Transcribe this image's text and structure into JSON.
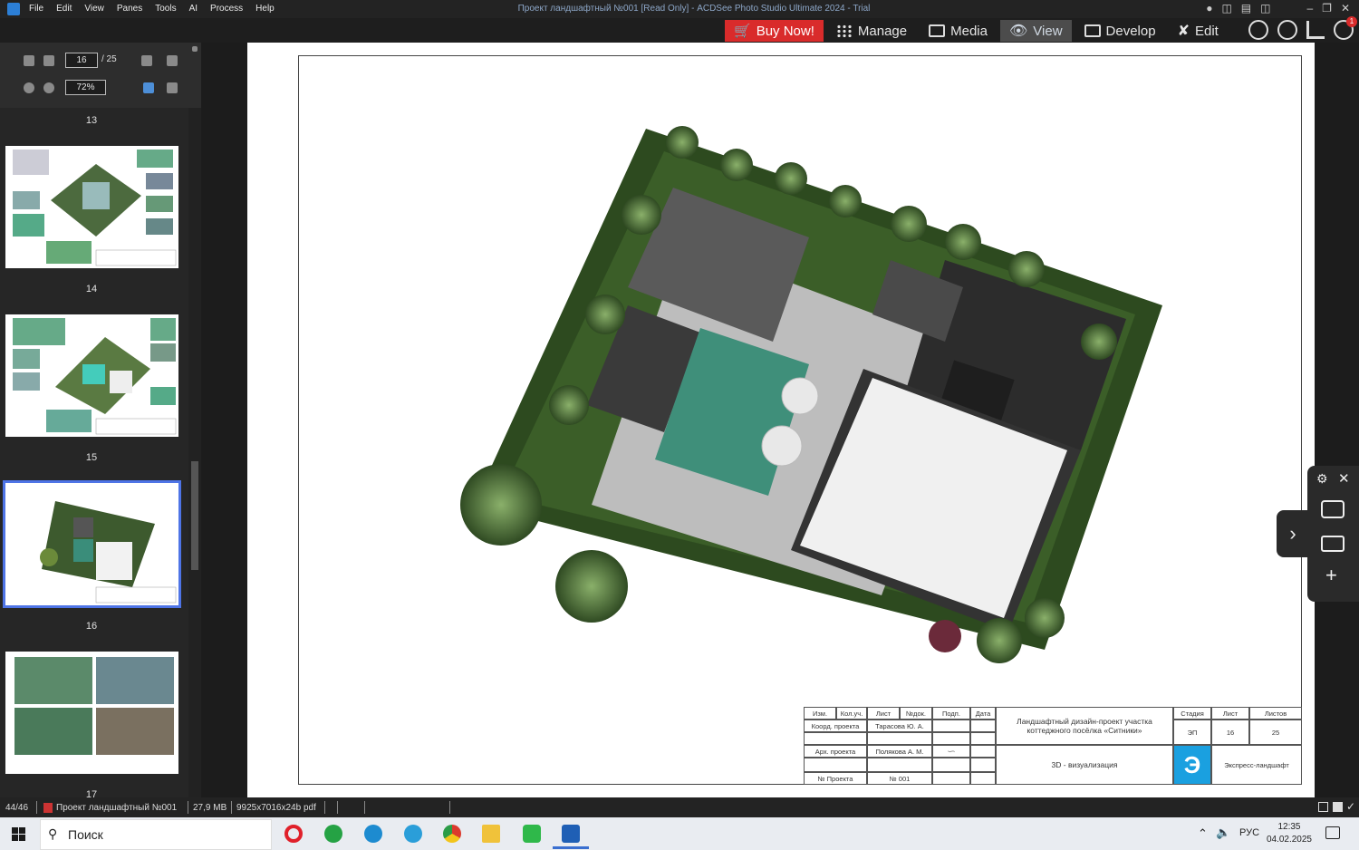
{
  "window": {
    "title": "Проект ландшафтный №001 [Read Only] - ACDSee Photo Studio Ultimate 2024 - Trial",
    "menu": [
      "File",
      "Edit",
      "View",
      "Panes",
      "Tools",
      "AI",
      "Process",
      "Help"
    ]
  },
  "modes": {
    "buy": "Buy Now!",
    "manage": "Manage",
    "media": "Media",
    "view": "View",
    "develop": "Develop",
    "edit": "Edit",
    "notif_count": "1"
  },
  "nav": {
    "page_current": "16",
    "page_total": "/ 25",
    "zoom": "72%"
  },
  "thumbs": [
    {
      "num": "13"
    },
    {
      "num": "14"
    },
    {
      "num": "15"
    },
    {
      "num": "16"
    },
    {
      "num": "17"
    }
  ],
  "titleblock": {
    "h_izm": "Изм.",
    "h_koluch": "Кол.уч.",
    "h_list": "Лист",
    "h_ndok": "№док.",
    "h_podp": "Подп.",
    "h_data": "Дата",
    "coord": "Коорд. проекта",
    "coord_name": "Тарасова Ю. А.",
    "arch": "Арх. проекта",
    "arch_name": "Полякова А. М.",
    "projnum_label": "№ Проекта",
    "projnum": "№ 001",
    "project_title": "Ландшафтный дизайн-проект участка коттеджного посёлка «Ситники»",
    "stage_h": "Стадия",
    "sheet_h": "Лист",
    "sheets_h": "Листов",
    "stage": "ЭП",
    "sheet": "16",
    "sheets": "25",
    "visual": "3D - визуализация",
    "logo": "Э",
    "company": "Экспресс-ландшафт"
  },
  "status": {
    "count": "44/46",
    "file": "Проект ландшафтный №001",
    "size": "27,9 МВ",
    "dims": "9925x7016x24b pdf"
  },
  "taskbar": {
    "search": "Поиск",
    "lang": "РУС",
    "time": "12:35",
    "date": "04.02.2025"
  }
}
